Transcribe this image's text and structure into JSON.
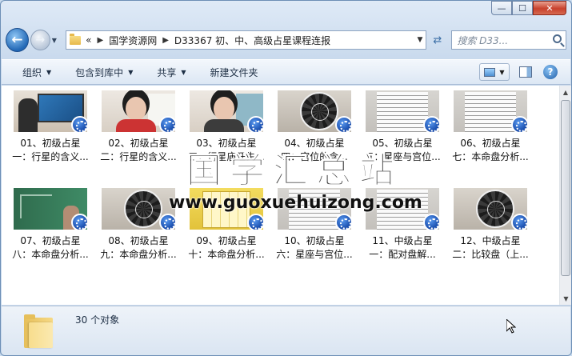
{
  "window": {
    "caption": {
      "minimize": "—",
      "maximize": "☐",
      "close": "✕"
    }
  },
  "nav": {
    "back_icon": "back-arrow-icon",
    "forward_icon": "forward-arrow-icon",
    "address": {
      "prefix": "«",
      "crumbs": [
        "国学资源网",
        "D33367 初、中、高级占星课程连报"
      ]
    },
    "search_placeholder": "搜索 D33..."
  },
  "toolbar": {
    "organize": "组织",
    "include_in_library": "包含到库中",
    "share": "共享",
    "new_folder": "新建文件夹"
  },
  "files": [
    {
      "line1": "01、初级占星",
      "line2": "一：行星的含义...",
      "thumb": "class"
    },
    {
      "line1": "02、初级占星",
      "line2": "二：行星的含义...",
      "thumb": "face"
    },
    {
      "line1": "03、初级占星",
      "line2": "三：行星庙旺失...",
      "thumb": "face2"
    },
    {
      "line1": "04、初级占星",
      "line2": "四：宫位的含...",
      "thumb": "chart"
    },
    {
      "line1": "05、初级占星",
      "line2": "五：星座与宫位...",
      "thumb": "doc"
    },
    {
      "line1": "06、初级占星",
      "line2": "七：本命盘分析...",
      "thumb": "doc"
    },
    {
      "line1": "07、初级占星",
      "line2": "八：本命盘分析...",
      "thumb": "green"
    },
    {
      "line1": "08、初级占星",
      "line2": "九：本命盘分析...",
      "thumb": "chart"
    },
    {
      "line1": "09、初级占星",
      "line2": "十：本命盘分析...",
      "thumb": "yellow"
    },
    {
      "line1": "10、初级占星",
      "line2": "六：星座与宫位...",
      "thumb": "doc"
    },
    {
      "line1": "11、中级占星",
      "line2": "一：配对盘解...",
      "thumb": "doc"
    },
    {
      "line1": "12、中级占星",
      "line2": "二：比较盘（上...",
      "thumb": "chart"
    }
  ],
  "watermark": {
    "title": "国学汇总站",
    "url": "www.guoxuehuizong.com"
  },
  "details": {
    "count": "30 个对象"
  }
}
